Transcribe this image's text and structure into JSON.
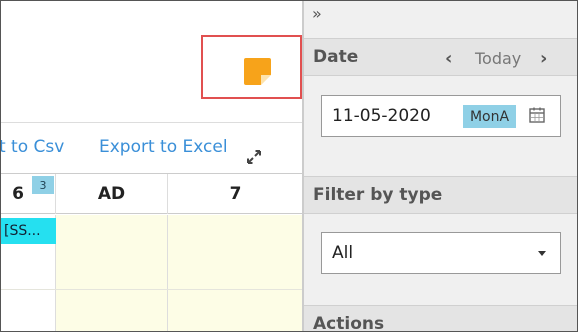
{
  "grid": {
    "export_csv_label": "rt to Csv",
    "export_excel_label": "Export to Excel",
    "columns": [
      {
        "label": "6",
        "badge": "3"
      },
      {
        "label": "AD"
      },
      {
        "label": "7"
      }
    ],
    "event_chip": "[SS..."
  },
  "sidebar": {
    "collapse_glyph": "»",
    "date": {
      "title": "Date",
      "prev_glyph": "‹",
      "today_label": "Today",
      "next_glyph": "›",
      "value": "11-05-2020",
      "day_label": "MonA"
    },
    "filter": {
      "title": "Filter by type",
      "selected": "All"
    },
    "actions": {
      "title": "Actions"
    }
  },
  "colors": {
    "note": "#f7a31a",
    "highlight": "#e15050",
    "link": "#3a8fd8",
    "chip": "#25e0f0",
    "badge": "#8fd0e6"
  },
  "icons": [
    "sticky-note-icon",
    "expand-icon",
    "calendar-icon",
    "chevron-left-icon",
    "chevron-right-icon",
    "double-chevron-right-icon",
    "caret-down-icon"
  ]
}
